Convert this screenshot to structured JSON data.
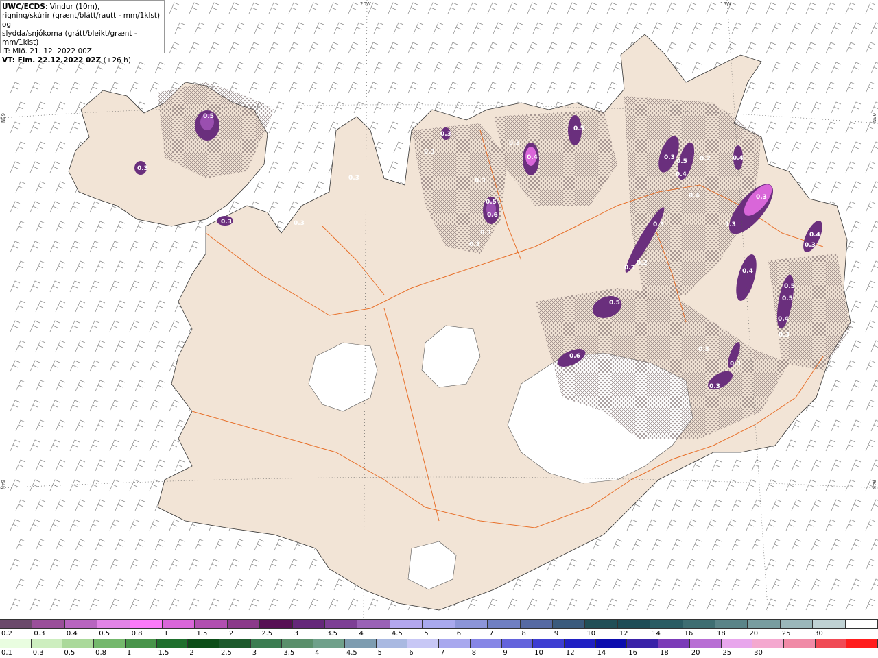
{
  "header": {
    "title_bold": "UWC/ECDS",
    "title_rest": ": Vindur (10m),",
    "line2": "rigning/skúrir (grænt/blátt/rautt - mm/1klst) og",
    "line3": "slydda/snjókoma (grátt/bleikt/grænt - mm/1klst)",
    "line4": "IT: Mið. 21. 12. 2022 00Z",
    "line5_bold": "VT: Fim. 22.12.2022 02Z",
    "line5_rest": " (+26 h)"
  },
  "grid_labels": {
    "lon_20w": "20W",
    "lon_15w": "15W",
    "lat_66n_left": "66N",
    "lat_66n_right": "66N",
    "lat_64n_left": "64N",
    "lat_64n_right": "64N"
  },
  "map": {
    "land_color": "#f2e4d6",
    "road_color": "#e8702a",
    "snow_label_color": "#ffffff",
    "snow_values": [
      "0.5",
      "0.3",
      "0.3",
      "0.3",
      "0.3",
      "0.3",
      "0.3",
      "0.3",
      "0.3",
      "0.5",
      "0.6",
      "0.3",
      "0.3",
      "0.4",
      "0.5",
      "0.3",
      "0.5",
      "0.4",
      "0.2",
      "0.4",
      "0.4",
      "0.3",
      "0.2",
      "0.3",
      "1.3",
      "0.3",
      "0.5",
      "0.4",
      "0.3",
      "0.4",
      "0.5",
      "0.5",
      "0.4",
      "0.3",
      "0.6",
      "0.3",
      "0.3",
      "0.3"
    ]
  },
  "colorbar_snow": {
    "colors": [
      "#6b4a6b",
      "#9a4f9a",
      "#b865c0",
      "#e284e6",
      "#fb7af8",
      "#d966d9",
      "#b14fb0",
      "#8b3a8a",
      "#571054",
      "#65287a",
      "#7d3f95",
      "#9a62b6",
      "#b3a7ee",
      "#a9a9ee",
      "#8c95d8",
      "#6f7fc2",
      "#566aa3",
      "#3b5b7d",
      "#214f57",
      "#1d4c56",
      "#2a5c63",
      "#3e6e72",
      "#5a8488",
      "#789da0",
      "#9bb7ba",
      "#c0d2d4",
      "#ffffff"
    ],
    "ticks": [
      "0.2",
      "0.3",
      "0.4",
      "0.5",
      "0.8",
      "1",
      "1.5",
      "2",
      "2.5",
      "3",
      "3.5",
      "4",
      "4.5",
      "5",
      "6",
      "7",
      "8",
      "9",
      "10",
      "12",
      "14",
      "16",
      "18",
      "20",
      "25",
      "30"
    ]
  },
  "colorbar_rain": {
    "colors": [
      "#e9fde0",
      "#cdeebf",
      "#aad99a",
      "#74b86c",
      "#48944a",
      "#1f6f2d",
      "#0c4e18",
      "#1d5a2c",
      "#3b7c51",
      "#5a8f6b",
      "#6fa08a",
      "#7d9cb0",
      "#a9b9e1",
      "#c7c7f5",
      "#a8a8ee",
      "#8686e6",
      "#6363dc",
      "#3e3ed2",
      "#2020c3",
      "#0c0cad",
      "#3a22a8",
      "#7b3bb8",
      "#b86ed4",
      "#e8a6ec",
      "#f4a8cf",
      "#f08aa6",
      "#f04a55",
      "#ff1d1d"
    ],
    "ticks": [
      "0.1",
      "0.3",
      "0.5",
      "0.8",
      "1",
      "1.5",
      "2",
      "2.5",
      "3",
      "3.5",
      "4",
      "4.5",
      "5",
      "6",
      "7",
      "8",
      "9",
      "10",
      "12",
      "14",
      "16",
      "18",
      "20",
      "25",
      "30"
    ]
  }
}
